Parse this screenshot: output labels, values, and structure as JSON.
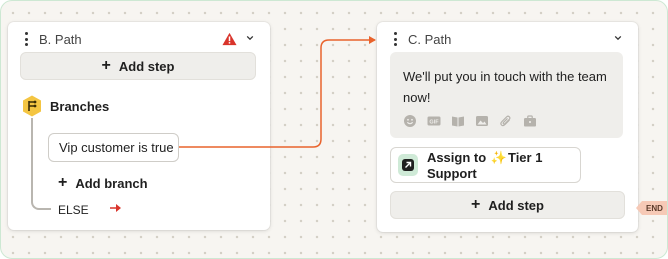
{
  "colors": {
    "accent_orange": "#e9632c",
    "branch_icon_bg": "#f4c542",
    "assign_icon_bg": "#cfead7",
    "warning_red": "#d9342b",
    "end_badge_bg": "#f6c9b6"
  },
  "nodes": {
    "b_path": {
      "title": "B. Path",
      "add_step_label": "Add step",
      "branches_label": "Branches",
      "branch_condition": "Vip customer is true",
      "add_branch_label": "Add branch",
      "else_label": "ELSE"
    },
    "c_path": {
      "title": "C. Path",
      "message_text": "We'll put you in touch with the team now!",
      "toolbar_icons": [
        "emoji-icon",
        "gif-icon",
        "article-icon",
        "image-icon",
        "attachment-icon",
        "briefcase-icon"
      ],
      "assign_prefix": "Assign to",
      "assign_target": "Tier 1 Support",
      "add_step_label": "Add step"
    }
  },
  "end_badge": "END"
}
